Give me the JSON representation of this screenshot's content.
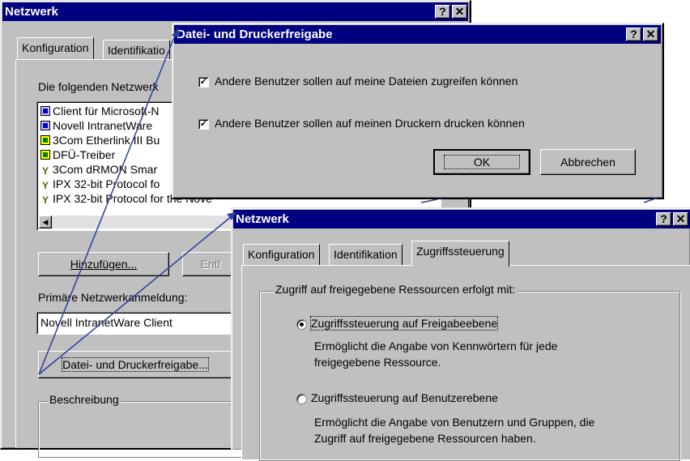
{
  "back_window": {
    "title": "Netzwerk",
    "title_buttons": [
      "?",
      "✕"
    ],
    "tabs": [
      "Konfiguration",
      "Identifikatio"
    ],
    "components_label": "Die folgenden Netzwerk",
    "components": [
      {
        "icon": "client-icon",
        "text": "Client für Microsoft-N"
      },
      {
        "icon": "client-icon",
        "text": "Novell IntranetWare"
      },
      {
        "icon": "network-adapter-icon",
        "text": "3Com Etherlink III Bu"
      },
      {
        "icon": "network-adapter-icon",
        "text": "DFÜ-Treiber"
      },
      {
        "icon": "protocol-icon",
        "text": "3Com dRMON Smar"
      },
      {
        "icon": "protocol-icon",
        "text": "IPX 32-bit Protocol fo"
      },
      {
        "icon": "protocol-icon",
        "text": "IPX 32-bit Protocol for the Nove"
      }
    ],
    "add_button": "Hinzufügen...",
    "remove_button": "Entf",
    "primary_logon_label": "Primäre Netzwerkanmeldung:",
    "primary_logon_value": "Novell IntranetWare Client",
    "file_print_button": "Datei- und Druckerfreigabe...",
    "description_label": "Beschreibung"
  },
  "share_dialog": {
    "title": "Datei- und Druckerfreigabe",
    "title_buttons": [
      "?",
      "✕"
    ],
    "option_files": "Andere Benutzer sollen auf meine Dateien zugreifen können",
    "option_printers": "Andere Benutzer sollen auf meinen Druckern drucken können",
    "option_files_checked": true,
    "option_printers_checked": true,
    "ok_button": "OK",
    "cancel_button": "Abbrechen"
  },
  "front_window": {
    "title": "Netzwerk",
    "title_buttons": [
      "?",
      "✕"
    ],
    "tabs": [
      "Konfiguration",
      "Identifikation",
      "Zugriffssteuerung"
    ],
    "active_tab": "Zugriffssteuerung",
    "group_label": "Zugriff auf freigegebene Ressourcen erfolgt mit:",
    "share_level_label": "Zugriffssteuerung auf Freigabeebene",
    "share_level_desc_1": "Ermöglicht die Angabe von Kennwörtern für jede",
    "share_level_desc_2": "freigegebene Ressource.",
    "user_level_label": "Zugriffssteuerung auf Benutzerebene",
    "user_level_desc_1": "Ermöglicht die Angabe von Benutzern und Gruppen, die",
    "user_level_desc_2": "Zugriff auf freigegebene Ressourcen haben.",
    "selected_option": "share-level"
  },
  "colors": {
    "titlebar": "#000080",
    "face": "#c0c0c0",
    "arrow": "#2a3f9a"
  }
}
